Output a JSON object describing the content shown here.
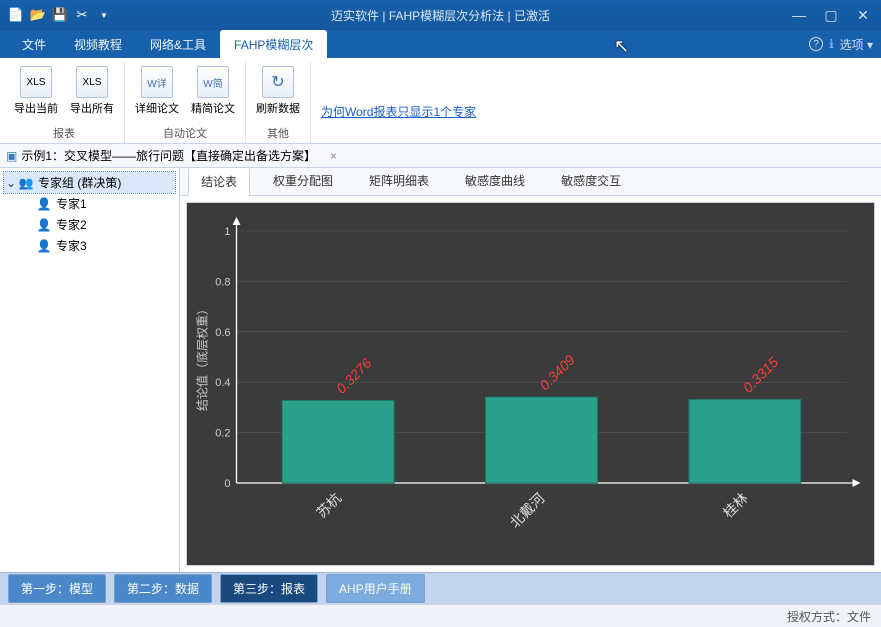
{
  "titlebar": {
    "title": "迈实软件 | FAHP模糊层次分析法 | 已激活"
  },
  "menu": {
    "file": "文件",
    "video": "视频教程",
    "network": "网络&工具",
    "fahp": "FAHP模糊层次",
    "options": "选项 ▾"
  },
  "ribbon": {
    "g1": {
      "btn1": "导出当前",
      "btn2": "导出所有",
      "label": "报表",
      "i1": "XLS",
      "i2": "XLS"
    },
    "g2": {
      "btn1": "详细论文",
      "btn2": "精简论文",
      "label": "自动论文",
      "i1": "W详",
      "i2": "W简"
    },
    "g3": {
      "btn1": "刷新数据",
      "label": "其他",
      "i1": "↻"
    },
    "link": "为何Word报表只显示1个专家"
  },
  "doc_tab": "示例1：交叉模型——旅行问题【直接确定出备选方案】",
  "tree": {
    "root": "专家组 (群决策)",
    "c1": "专家1",
    "c2": "专家2",
    "c3": "专家3"
  },
  "subtabs": {
    "t1": "结论表",
    "t2": "权重分配图",
    "t3": "矩阵明细表",
    "t4": "敏感度曲线",
    "t5": "敏感度交互"
  },
  "chart_data": {
    "type": "bar",
    "ylabel": "结论值（底层权重）",
    "categories": [
      "苏杭",
      "北戴河",
      "桂林"
    ],
    "values": [
      0.3276,
      0.3409,
      0.3315
    ],
    "value_labels": [
      "0.3276",
      "0.3409",
      "0.3315"
    ],
    "yticks": [
      "0",
      "0.2",
      "0.4",
      "0.6",
      "0.8",
      "1"
    ],
    "ylim": [
      0,
      1
    ]
  },
  "steps": {
    "s1": "第一步：模型",
    "s2": "第二步：数据",
    "s3": "第三步：报表",
    "s4": "AHP用户手册"
  },
  "status": "授权方式：文件"
}
